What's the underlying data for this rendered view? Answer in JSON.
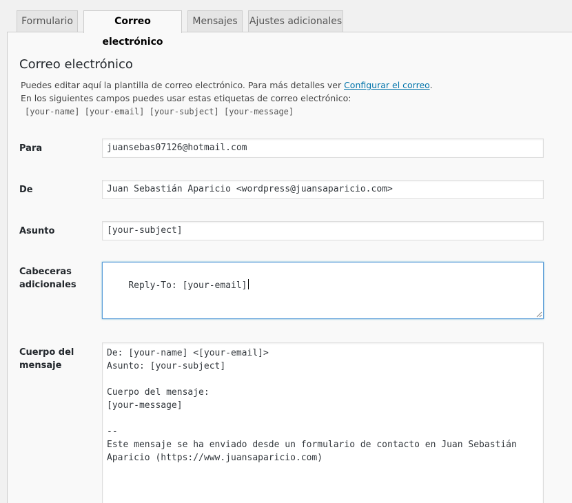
{
  "tabs": [
    {
      "label": "Formulario",
      "active": false
    },
    {
      "label": "Correo electrónico",
      "active": true
    },
    {
      "label": "Mensajes",
      "active": false
    },
    {
      "label": "Ajustes adicionales",
      "active": false
    }
  ],
  "panel": {
    "title": "Correo electrónico",
    "desc_line1_prefix": "Puedes editar aquí la plantilla de correo electrónico. Para más detalles ver ",
    "desc_link": "Configurar el correo",
    "desc_line1_suffix": ".",
    "desc_line2": "En los siguientes campos puedes usar estas etiquetas de correo electrónico:",
    "tags": "[your-name] [your-email] [your-subject] [your-message]"
  },
  "fields": {
    "to": {
      "label": "Para",
      "value": "juansebas07126@hotmail.com"
    },
    "from": {
      "label": "De",
      "value": "Juan Sebastián Aparicio <wordpress@juansaparicio.com>"
    },
    "subject": {
      "label": "Asunto",
      "value": "[your-subject]"
    },
    "headers": {
      "label_line1": "Cabeceras",
      "label_line2": "adicionales",
      "value": "Reply-To: [your-email]"
    },
    "body": {
      "label_line1": "Cuerpo del",
      "label_line2": "mensaje",
      "value": "De: [your-name] <[your-email]>\nAsunto: [your-subject]\n\nCuerpo del mensaje:\n[your-message]\n\n--\nEste mensaje se ha enviado desde un formulario de contacto en Juan Sebastián\nAparicio (https://www.juansaparicio.com)"
    }
  },
  "colors": {
    "link": "#0073aa",
    "focus_border": "#5b9dd9",
    "panel_bg": "#f9f9f9",
    "tab_bg": "#e5e5e5"
  }
}
